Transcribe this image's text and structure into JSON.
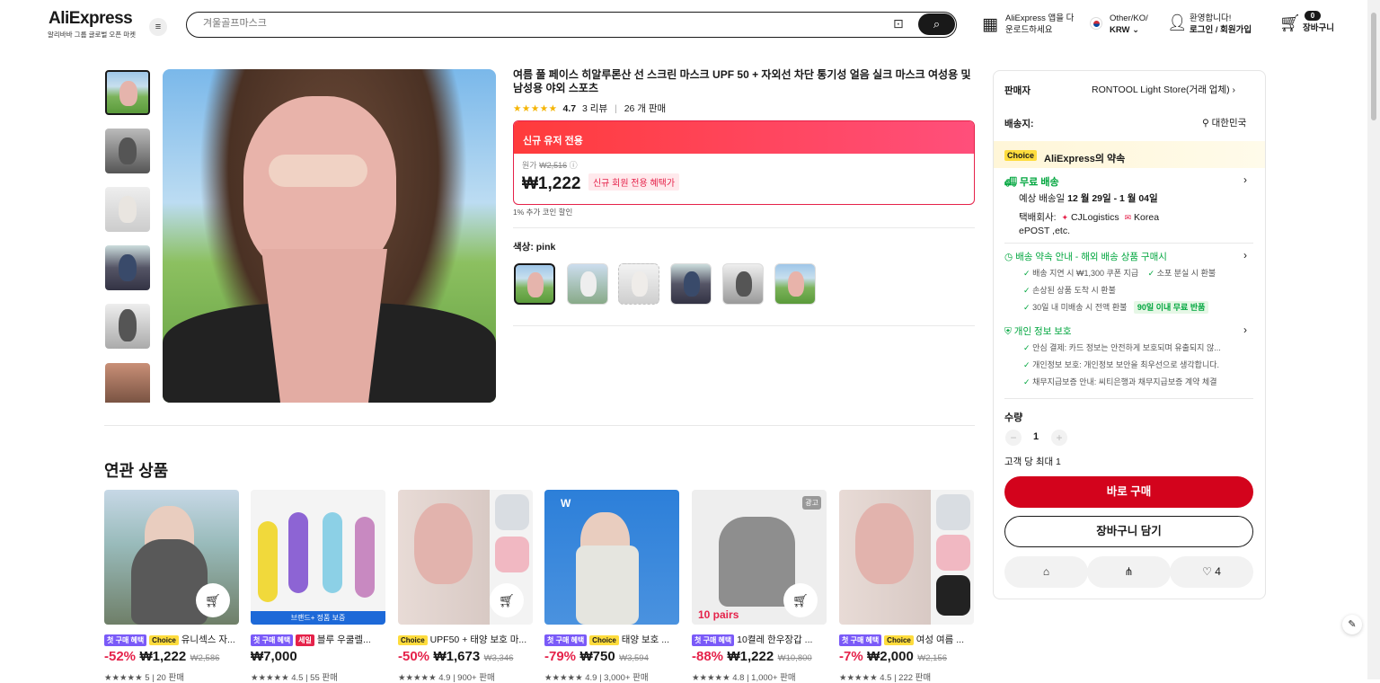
{
  "header": {
    "logo": "AliExpress",
    "logo_sub": "알리바바 그룹 글로벌 오픈 마켓",
    "search_placeholder": "겨울골프마스크",
    "app_line1": "AliExpress 앱을 다",
    "app_line2": "운로드하세요",
    "region_line1": "Other/KO/",
    "region_line2": "KRW",
    "account_line1": "환영합니다!",
    "account_line2": "로그인 / 회원가입",
    "cart_count": "0",
    "cart_label": "장바구니"
  },
  "product": {
    "title": "여름 풀 페이스 히알루론산 선 스크린 마스크 UPF 50 + 자외선 차단 통기성 얼음 실크 마스크 여성용 및 남성용 야외 스포츠",
    "stars": "★★★★★",
    "rating": "4.7",
    "reviews": "3 리뷰",
    "separator": "|",
    "sold": "26 개 판매",
    "promo_header": "신규 유저 전용",
    "original_label": "원가",
    "original_price": "₩2,516",
    "info_icon": "ⓘ",
    "price": "₩1,222",
    "price_tag": "신규 회원 전용 혜택가",
    "coin_note": "1% 추가 코인 할인",
    "color_label": "색상:",
    "color_value": "pink"
  },
  "panel": {
    "seller_label": "판매자",
    "seller_name": "RONTOOL Light Store(거래 업체)",
    "ship_to_label": "배송지:",
    "ship_to_value": "대한민국",
    "choice_tag": "Choice",
    "promise_title": "AliExpress의 약속",
    "free_ship": "무료 배송",
    "eta_prefix": "예상 배송일",
    "eta_value": "12 월 29일 - 1 월 04일",
    "carrier_prefix": "택배회사:",
    "carrier_1": "CJLogistics",
    "carrier_2": "Korea",
    "carrier_3": "ePOST ,etc.",
    "guarantee_title": "배송 약속 안내 - 해외 배송 상품 구매시",
    "g1": "배송 지연 시 ₩1,300 쿠폰 지급",
    "g2": "소포 분실 시 환불",
    "g3": "손상된 상품 도착 시 환불",
    "g4": "30일 내 미배송 시 전액 환불",
    "g4_badge": "90일 이내 무료 반품",
    "privacy_title": "개인 정보 보호",
    "p1": "안심 결제: 카드 정보는 안전하게 보호되며 유출되지 않...",
    "p2": "개인정보 보호: 개인정보 보안을 최우선으로 생각합니다.",
    "p3": "채무지급보증 안내: 씨티은행과 채무지급보증 계약 체결",
    "qty_label": "수량",
    "qty_minus": "−",
    "qty_value": "1",
    "qty_plus": "+",
    "qty_limit": "고객 당 최대 1",
    "buy_now": "바로 구매",
    "add_cart": "장바구니 담기",
    "wish_count": "4"
  },
  "related": {
    "title": "연관 상품",
    "items": [
      {
        "t1": "첫 구매 혜택",
        "t2": "Choice",
        "name": "유니섹스 자...",
        "disc": "-52%",
        "price": "₩1,222",
        "orig": "₩2,586",
        "rating": "★★★★★ 5 | 20 판매"
      },
      {
        "t1": "첫 구매 혜택",
        "t2": "세일",
        "name": "블루 우쿨렐...",
        "disc": "",
        "price": "₩7,000",
        "orig": "",
        "rating": "★★★★★ 4.5 | 55 판매",
        "banner": "브랜드+ 정품 보증"
      },
      {
        "t1": "",
        "t2": "Choice",
        "name": "UPF50 + 태양 보호 마...",
        "disc": "-50%",
        "price": "₩1,673",
        "orig": "₩3,346",
        "rating": "★★★★★ 4.9 | 900+ 판매"
      },
      {
        "t1": "첫 구매 혜택",
        "t2": "Choice",
        "name": "태양 보호 ...",
        "disc": "-79%",
        "price": "₩750",
        "orig": "₩3,594",
        "rating": "★★★★★ 4.9 | 3,000+ 판매"
      },
      {
        "t1": "첫 구매 혜택",
        "t2": "",
        "name": "10켤레 한우장갑 ...",
        "disc": "-88%",
        "price": "₩1,222",
        "orig": "₩10,800",
        "rating": "★★★★★ 4.8 | 1,000+ 판매",
        "ad": "광고",
        "overlay": "10 pairs"
      },
      {
        "t1": "첫 구매 혜택",
        "t2": "Choice",
        "name": "여성 여름 ...",
        "disc": "-7%",
        "price": "₩2,000",
        "orig": "₩2,156",
        "rating": "★★★★★ 4.5 | 222 판매"
      }
    ]
  }
}
